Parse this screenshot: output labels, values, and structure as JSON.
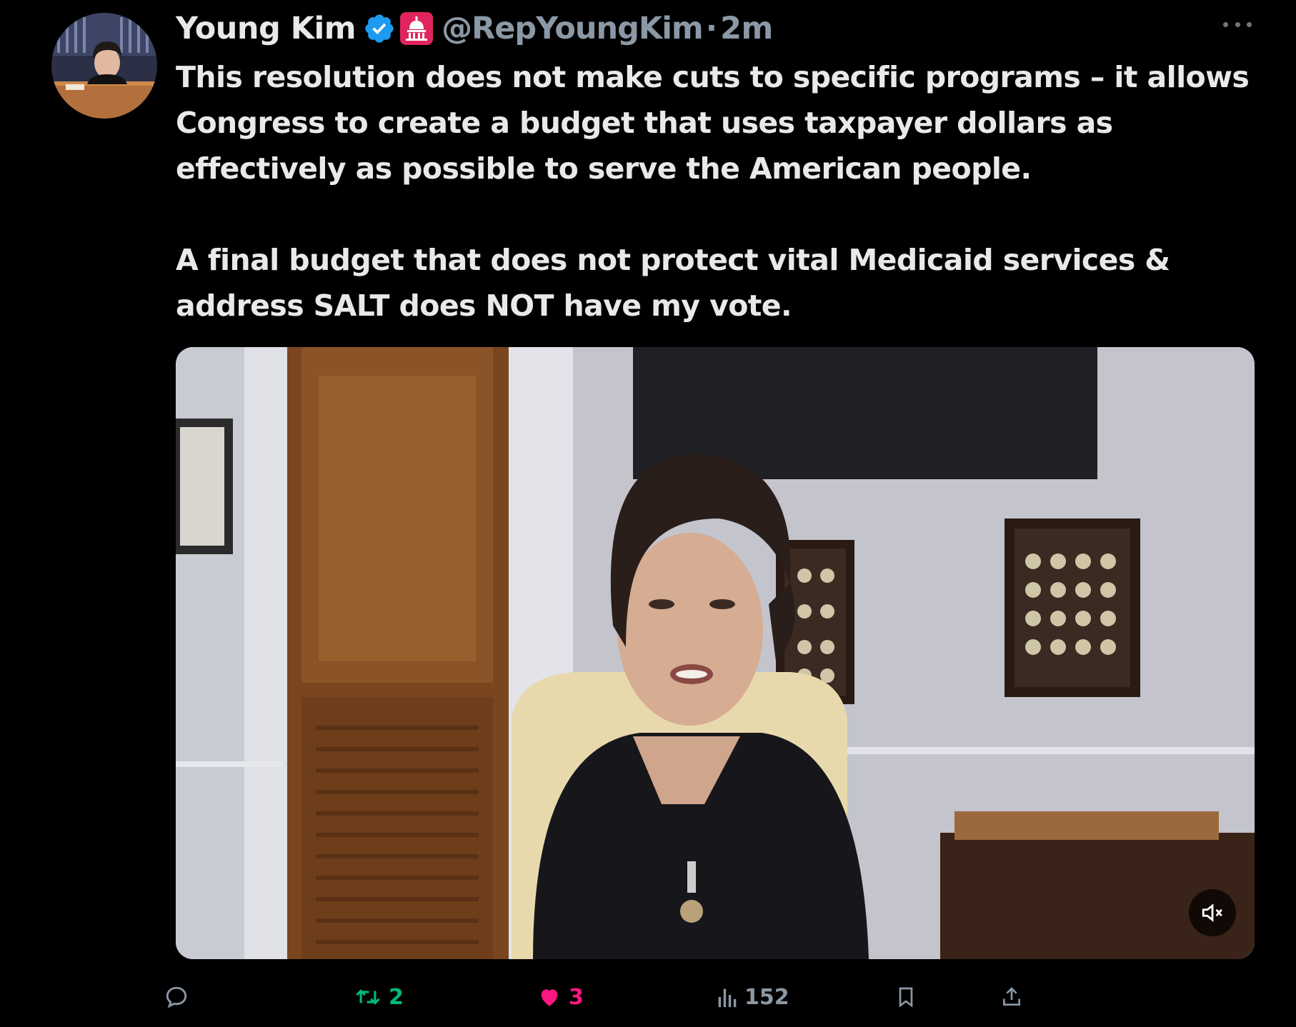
{
  "author": {
    "name": "Young Kim",
    "handle": "@RepYoungKim",
    "separator": "·",
    "time": "2m",
    "avatar_icon": "avatar-photo",
    "verified_icon": "verified-badge-icon",
    "affiliation_icon": "capitol-dome-icon"
  },
  "tweet": {
    "paragraphs": [
      "This resolution does not make cuts to specific programs – it allows Congress to create a budget that uses taxpayer dollars as effectively as possible to serve the American people.",
      "A final budget that does not protect vital Medicaid services & address SALT does NOT have my vote."
    ]
  },
  "media": {
    "type": "video",
    "muted": true,
    "mute_icon": "speaker-muted-icon"
  },
  "actions": {
    "reply": {
      "icon": "reply-icon",
      "count": ""
    },
    "retweet": {
      "icon": "retweet-icon",
      "count": "2",
      "color": "#00ba7c"
    },
    "like": {
      "icon": "heart-icon",
      "count": "3",
      "color": "#f91880"
    },
    "views": {
      "icon": "views-icon",
      "count": "152"
    },
    "bookmark": {
      "icon": "bookmark-icon"
    },
    "share": {
      "icon": "share-icon"
    }
  },
  "colors": {
    "background": "#000000",
    "text": "#e7e9ea",
    "muted": "#8b98a5",
    "verified": "#1d9bf0",
    "gov_badge": "#e0245e"
  }
}
